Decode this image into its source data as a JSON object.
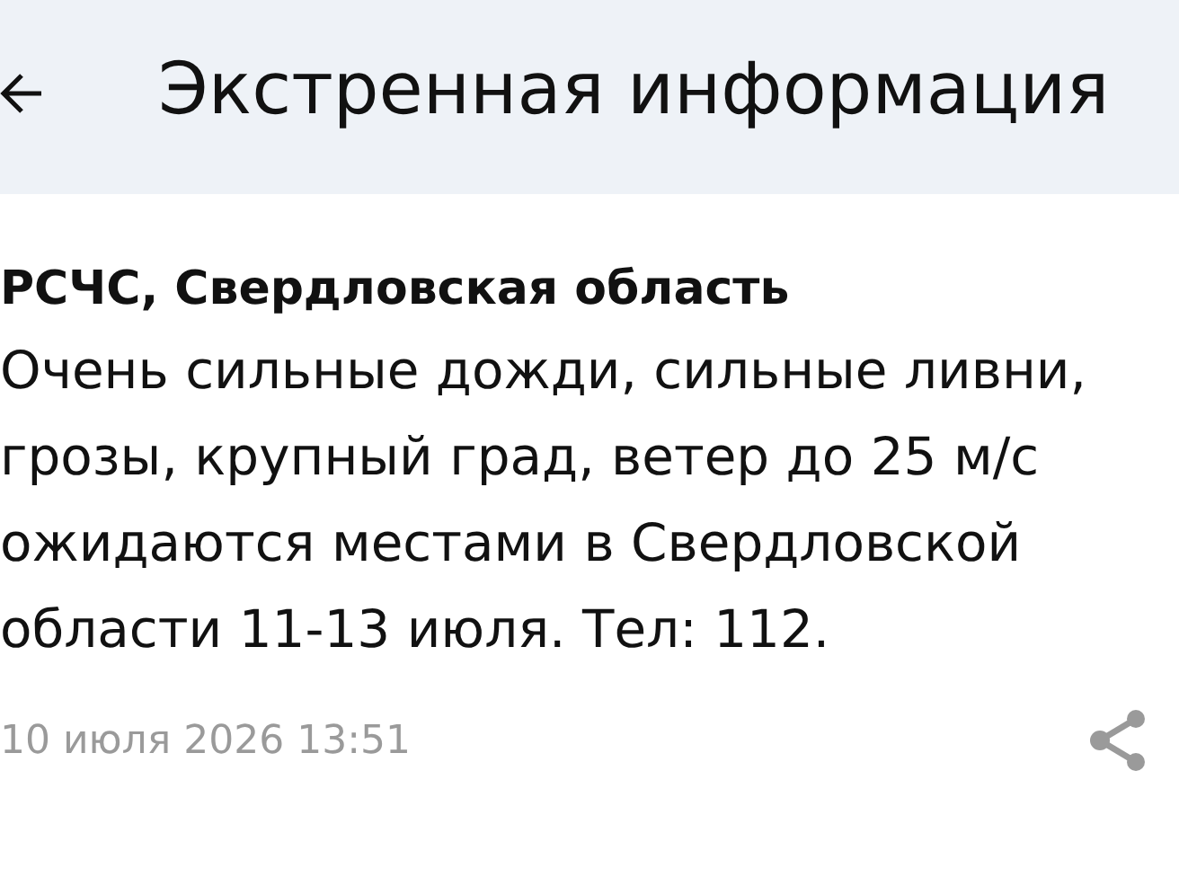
{
  "header": {
    "title": "Экстренная информация"
  },
  "message": {
    "source": "РСЧС, Свердловская область",
    "lines": [
      "Очень сильные дожди, сильные ливни,",
      "грозы, крупный град, ветер до 25 м/с",
      "ожидаются местами в Свердловской",
      "области 11-13 июля. Тел: 112."
    ],
    "date": "10 июля 2026 13:51"
  }
}
